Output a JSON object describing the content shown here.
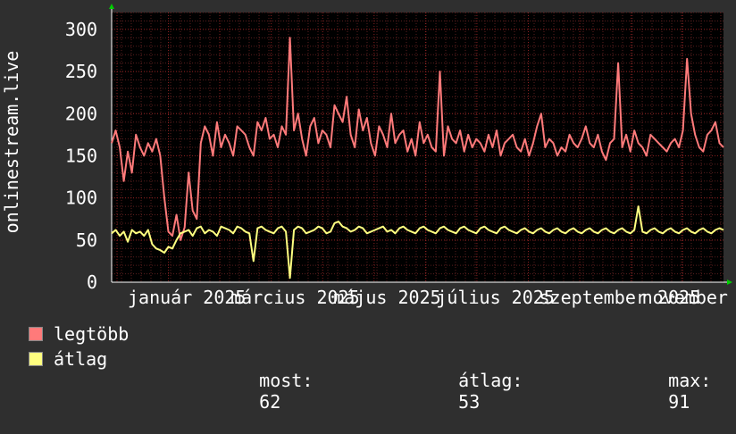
{
  "chart_data": {
    "type": "line",
    "ylabel": "onlinestream.live",
    "ylim": [
      0,
      320
    ],
    "yticks": [
      0,
      50,
      100,
      150,
      200,
      250,
      300
    ],
    "x_tick_labels": [
      "január 2025",
      "március 2025",
      "május 2025",
      "július 2025",
      "szeptember 2025",
      "november 2025"
    ],
    "grid": true,
    "colors": {
      "background": "#2f2f2f",
      "plot": "#000000",
      "grid": "#5a1e1e",
      "axis": "#ffffff",
      "max": "#ff7a7a",
      "avg": "#ffff80"
    },
    "series": [
      {
        "name": "legtöbb",
        "color": "#ff7a7a",
        "values": [
          165,
          180,
          160,
          120,
          155,
          130,
          175,
          160,
          150,
          165,
          155,
          170,
          150,
          100,
          60,
          55,
          80,
          50,
          65,
          130,
          85,
          75,
          165,
          185,
          175,
          150,
          190,
          160,
          175,
          165,
          150,
          185,
          180,
          175,
          160,
          150,
          190,
          180,
          195,
          170,
          175,
          160,
          185,
          175,
          290,
          180,
          200,
          170,
          150,
          185,
          195,
          165,
          180,
          175,
          160,
          210,
          200,
          190,
          220,
          175,
          160,
          205,
          180,
          195,
          165,
          150,
          185,
          175,
          160,
          200,
          165,
          175,
          180,
          155,
          170,
          150,
          190,
          165,
          175,
          160,
          155,
          250,
          150,
          185,
          170,
          165,
          180,
          155,
          175,
          160,
          170,
          165,
          155,
          175,
          160,
          180,
          150,
          165,
          170,
          175,
          160,
          155,
          170,
          150,
          165,
          185,
          200,
          160,
          170,
          165,
          150,
          160,
          155,
          175,
          165,
          160,
          170,
          185,
          165,
          160,
          175,
          155,
          145,
          165,
          170,
          260,
          160,
          175,
          155,
          180,
          165,
          160,
          150,
          175,
          170,
          165,
          160,
          155,
          165,
          170,
          160,
          180,
          265,
          200,
          175,
          160,
          155,
          175,
          180,
          190,
          165,
          160
        ]
      },
      {
        "name": "átlag",
        "color": "#ffff80",
        "values": [
          58,
          62,
          55,
          60,
          48,
          62,
          58,
          60,
          55,
          62,
          45,
          40,
          38,
          35,
          42,
          40,
          50,
          58,
          60,
          62,
          55,
          64,
          66,
          58,
          62,
          60,
          55,
          66,
          64,
          62,
          58,
          66,
          64,
          60,
          58,
          25,
          64,
          66,
          62,
          60,
          58,
          64,
          66,
          60,
          5,
          62,
          66,
          64,
          58,
          60,
          62,
          66,
          64,
          58,
          60,
          70,
          72,
          66,
          64,
          60,
          62,
          66,
          64,
          58,
          60,
          62,
          64,
          66,
          60,
          62,
          58,
          64,
          66,
          62,
          60,
          58,
          64,
          66,
          62,
          60,
          58,
          64,
          66,
          62,
          60,
          58,
          64,
          66,
          62,
          60,
          58,
          64,
          66,
          62,
          60,
          58,
          64,
          66,
          62,
          60,
          58,
          62,
          64,
          60,
          58,
          62,
          64,
          60,
          58,
          62,
          64,
          60,
          58,
          62,
          64,
          60,
          58,
          62,
          64,
          60,
          58,
          62,
          64,
          60,
          58,
          62,
          64,
          60,
          58,
          62,
          90,
          60,
          58,
          62,
          64,
          60,
          58,
          62,
          64,
          60,
          58,
          62,
          64,
          60,
          58,
          62,
          64,
          60,
          58,
          62,
          64,
          62
        ]
      }
    ]
  },
  "legend": {
    "max_label": "legtöbb",
    "avg_label": "átlag"
  },
  "stats": {
    "current_label": "most:",
    "current_value": "62",
    "avg_label": "átlag:",
    "avg_value": "53",
    "max_label": "max:",
    "max_value": "91"
  }
}
